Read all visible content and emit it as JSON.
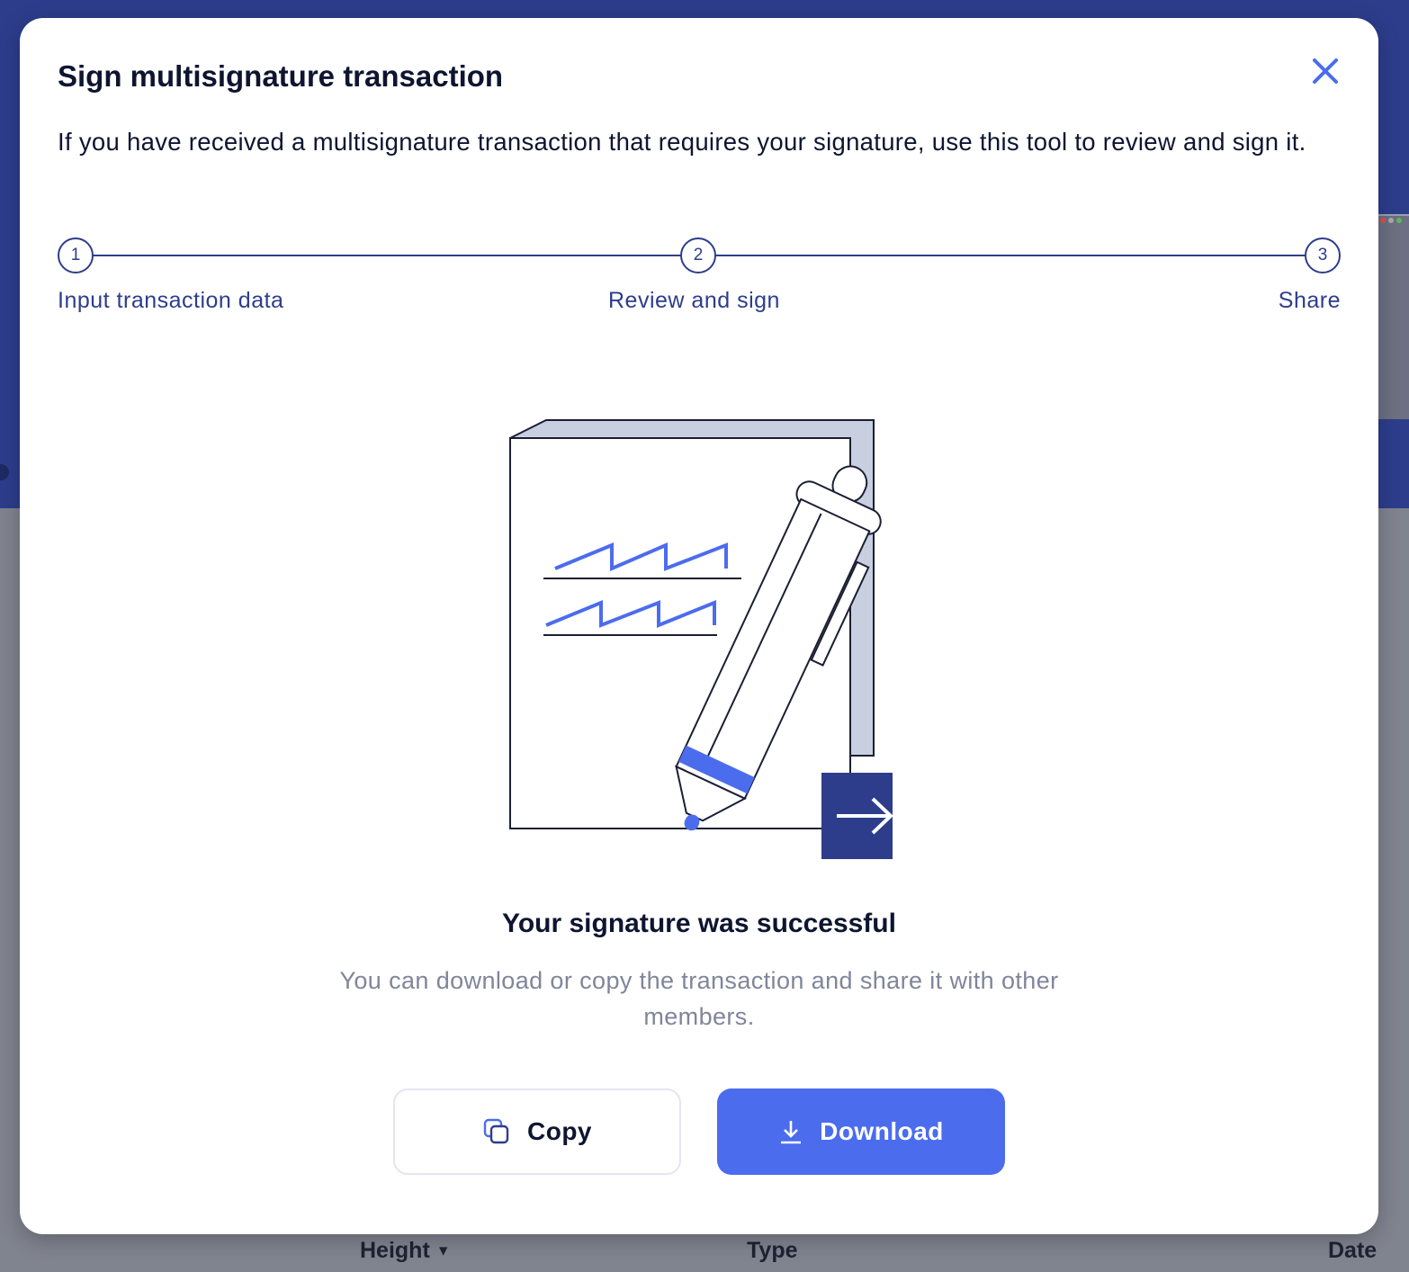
{
  "modal": {
    "title": "Sign multisignature transaction",
    "description": "If you have received a multisignature transaction that requires your signature, use this tool to review and sign it."
  },
  "stepper": {
    "steps": [
      {
        "number": "1",
        "label": "Input transaction data"
      },
      {
        "number": "2",
        "label": "Review and sign"
      },
      {
        "number": "3",
        "label": "Share"
      }
    ],
    "current_step": 3
  },
  "result": {
    "title": "Your signature was successful",
    "message": "You can download or copy the transaction and share it with other members."
  },
  "actions": {
    "copy_label": "Copy",
    "download_label": "Download"
  },
  "background_table": {
    "columns": [
      "Height",
      "Type",
      "Date"
    ]
  },
  "icons": {
    "close": "close-icon",
    "copy": "copy-icon",
    "download": "download-icon",
    "sort": "caret-down-icon"
  },
  "colors": {
    "primary_navy": "#2d3d8c",
    "accent_blue": "#4c6cee",
    "text_dark": "#0e1530",
    "text_muted": "#80859a"
  }
}
